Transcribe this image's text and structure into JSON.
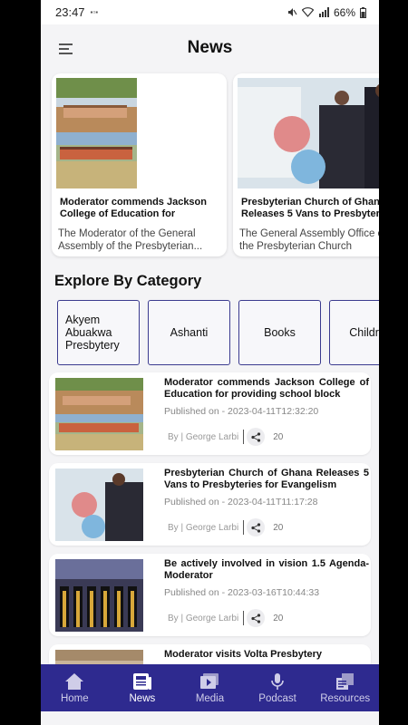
{
  "status_bar": {
    "time": "23:47",
    "battery": "66%"
  },
  "header": {
    "title": "News"
  },
  "featured": [
    {
      "title": "Moderator commends Jackson College of Education for",
      "excerpt": "The Moderator of the General Assembly of the Presbyterian..."
    },
    {
      "title": "Presbyterian Church of Ghana Releases 5 Vans to Presbyteries",
      "excerpt": "The General Assembly Office of the Presbyterian Church"
    }
  ],
  "categories_section": {
    "title": "Explore By Category",
    "items": [
      "Akyem Abuakwa Presbytery",
      "Ashanti",
      "Books",
      "Children"
    ]
  },
  "news": [
    {
      "title": "Moderator commends Jackson College of Education for providing school block",
      "date": "Published on - 2023-04-11T12:32:20",
      "author": "By | George Larbi",
      "shares": "20"
    },
    {
      "title": "Presbyterian Church of Ghana Releases 5 Vans to Presbyteries for Evangelism",
      "date": "Published on - 2023-04-11T11:17:28",
      "author": "By | George Larbi",
      "shares": "20"
    },
    {
      "title": "Be actively involved in vision 1.5 Agenda-Moderator",
      "date": "Published on - 2023-03-16T10:44:33",
      "author": "By | George Larbi",
      "shares": "20"
    },
    {
      "title": "Moderator visits Volta Presbytery",
      "date": "",
      "author": "",
      "shares": ""
    }
  ],
  "bottom_nav": [
    {
      "label": "Home",
      "icon": "home-icon"
    },
    {
      "label": "News",
      "icon": "news-icon",
      "active": true
    },
    {
      "label": "Media",
      "icon": "media-icon"
    },
    {
      "label": "Podcast",
      "icon": "podcast-icon"
    },
    {
      "label": "Resources",
      "icon": "resources-icon"
    }
  ],
  "colors": {
    "primary": "#2e2a8f",
    "category_border": "#3b3b8f"
  }
}
